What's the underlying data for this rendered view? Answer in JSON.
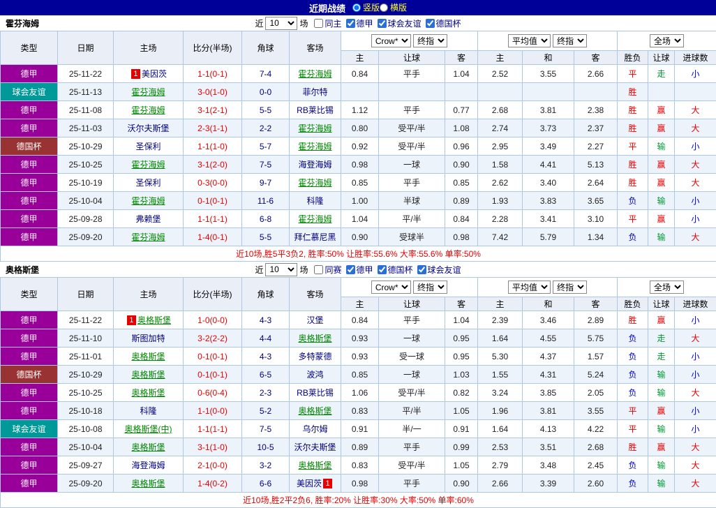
{
  "titlebar": {
    "title": "近期战绩",
    "radios": [
      {
        "label": "竖版",
        "selected": true
      },
      {
        "label": "横版",
        "selected": false
      }
    ]
  },
  "colors": {
    "titlebar_bg": "#000099",
    "type_colors": {
      "德甲": "#990099",
      "球会友谊": "#009999",
      "德国杯": "#993333"
    },
    "result_colors": {
      "red": "#e60000",
      "green": "#009933",
      "blue": "#0000cc"
    },
    "focus_team": "#008800",
    "team": "#000080",
    "score": "#e60000",
    "summary": "#e60000",
    "rank_badge": "#e60000"
  },
  "sections": [
    {
      "team": "霍芬海姆",
      "filter": {
        "near": "近",
        "count": "10",
        "games": "场",
        "checkboxes": [
          {
            "label": "同主",
            "checked": false
          },
          {
            "label": "德甲",
            "checked": true
          },
          {
            "label": "球会友谊",
            "checked": true
          },
          {
            "label": "德国杯",
            "checked": true
          }
        ]
      },
      "header": {
        "cols": [
          "类型",
          "日期",
          "主场",
          "比分(半场)",
          "角球",
          "客场"
        ],
        "odds_group": [
          "Crow*",
          "终指"
        ],
        "avg_group": [
          "平均值",
          "终指"
        ],
        "full_group": [
          "全场"
        ],
        "sub": [
          "主",
          "让球",
          "客",
          "主",
          "和",
          "客",
          "胜负",
          "让球",
          "进球数"
        ]
      },
      "rows": [
        {
          "type": "德甲",
          "date": "25-11-22",
          "home": {
            "name": "美因茨",
            "badge": "1",
            "badge_pos": "before",
            "focus": false
          },
          "score": "1-1(0-1)",
          "corners": "7-4",
          "away": {
            "name": "霍芬海姆",
            "focus": true
          },
          "odds": [
            "0.84",
            "平手",
            "1.04"
          ],
          "avg": [
            "2.52",
            "3.55",
            "2.66"
          ],
          "results": [
            {
              "text": "平",
              "color": "red"
            },
            {
              "text": "走",
              "color": "green"
            },
            {
              "text": "小",
              "color": "blue"
            }
          ]
        },
        {
          "type": "球会友谊",
          "date": "25-11-13",
          "home": {
            "name": "霍芬海姆",
            "focus": true
          },
          "score": "3-0(1-0)",
          "corners": "0-0",
          "away": {
            "name": "菲尔特",
            "focus": false
          },
          "odds": [
            "",
            "",
            ""
          ],
          "avg": [
            "",
            "",
            ""
          ],
          "results": [
            {
              "text": "胜",
              "color": "red"
            },
            {
              "text": "",
              "color": ""
            },
            {
              "text": "",
              "color": ""
            }
          ]
        },
        {
          "type": "德甲",
          "date": "25-11-08",
          "home": {
            "name": "霍芬海姆",
            "focus": true
          },
          "score": "3-1(2-1)",
          "corners": "5-5",
          "away": {
            "name": "RB莱比锡",
            "focus": false
          },
          "odds": [
            "1.12",
            "平手",
            "0.77"
          ],
          "avg": [
            "2.68",
            "3.81",
            "2.38"
          ],
          "results": [
            {
              "text": "胜",
              "color": "red"
            },
            {
              "text": "赢",
              "color": "red"
            },
            {
              "text": "大",
              "color": "red"
            }
          ]
        },
        {
          "type": "德甲",
          "date": "25-11-03",
          "home": {
            "name": "沃尔夫斯堡",
            "focus": false
          },
          "score": "2-3(1-1)",
          "corners": "2-2",
          "away": {
            "name": "霍芬海姆",
            "focus": true
          },
          "odds": [
            "0.80",
            "受平/半",
            "1.08"
          ],
          "avg": [
            "2.74",
            "3.73",
            "2.37"
          ],
          "results": [
            {
              "text": "胜",
              "color": "red"
            },
            {
              "text": "赢",
              "color": "red"
            },
            {
              "text": "大",
              "color": "red"
            }
          ]
        },
        {
          "type": "德国杯",
          "date": "25-10-29",
          "home": {
            "name": "圣保利",
            "focus": false
          },
          "score": "1-1(1-0)",
          "corners": "5-7",
          "away": {
            "name": "霍芬海姆",
            "focus": true
          },
          "odds": [
            "0.92",
            "受平/半",
            "0.96"
          ],
          "avg": [
            "2.95",
            "3.49",
            "2.27"
          ],
          "results": [
            {
              "text": "平",
              "color": "red"
            },
            {
              "text": "输",
              "color": "green"
            },
            {
              "text": "小",
              "color": "blue"
            }
          ]
        },
        {
          "type": "德甲",
          "date": "25-10-25",
          "home": {
            "name": "霍芬海姆",
            "focus": true
          },
          "score": "3-1(2-0)",
          "corners": "7-5",
          "away": {
            "name": "海登海姆",
            "focus": false
          },
          "odds": [
            "0.98",
            "一球",
            "0.90"
          ],
          "avg": [
            "1.58",
            "4.41",
            "5.13"
          ],
          "results": [
            {
              "text": "胜",
              "color": "red"
            },
            {
              "text": "赢",
              "color": "red"
            },
            {
              "text": "大",
              "color": "red"
            }
          ]
        },
        {
          "type": "德甲",
          "date": "25-10-19",
          "home": {
            "name": "圣保利",
            "focus": false
          },
          "score": "0-3(0-0)",
          "corners": "9-7",
          "away": {
            "name": "霍芬海姆",
            "focus": true
          },
          "odds": [
            "0.85",
            "平手",
            "0.85"
          ],
          "avg": [
            "2.62",
            "3.40",
            "2.64"
          ],
          "results": [
            {
              "text": "胜",
              "color": "red"
            },
            {
              "text": "赢",
              "color": "red"
            },
            {
              "text": "大",
              "color": "red"
            }
          ]
        },
        {
          "type": "德甲",
          "date": "25-10-04",
          "home": {
            "name": "霍芬海姆",
            "focus": true
          },
          "score": "0-1(0-1)",
          "corners": "11-6",
          "away": {
            "name": "科隆",
            "focus": false
          },
          "odds": [
            "1.00",
            "半球",
            "0.89"
          ],
          "avg": [
            "1.93",
            "3.83",
            "3.65"
          ],
          "results": [
            {
              "text": "负",
              "color": "blue"
            },
            {
              "text": "输",
              "color": "green"
            },
            {
              "text": "小",
              "color": "blue"
            }
          ]
        },
        {
          "type": "德甲",
          "date": "25-09-28",
          "home": {
            "name": "弗赖堡",
            "focus": false
          },
          "score": "1-1(1-1)",
          "corners": "6-8",
          "away": {
            "name": "霍芬海姆",
            "focus": true
          },
          "odds": [
            "1.04",
            "平/半",
            "0.84"
          ],
          "avg": [
            "2.28",
            "3.41",
            "3.10"
          ],
          "results": [
            {
              "text": "平",
              "color": "red"
            },
            {
              "text": "赢",
              "color": "red"
            },
            {
              "text": "小",
              "color": "blue"
            }
          ]
        },
        {
          "type": "德甲",
          "date": "25-09-20",
          "home": {
            "name": "霍芬海姆",
            "focus": true
          },
          "score": "1-4(0-1)",
          "corners": "5-5",
          "away": {
            "name": "拜仁慕尼黑",
            "focus": false
          },
          "odds": [
            "0.90",
            "受球半",
            "0.98"
          ],
          "avg": [
            "7.42",
            "5.79",
            "1.34"
          ],
          "results": [
            {
              "text": "负",
              "color": "blue"
            },
            {
              "text": "输",
              "color": "green"
            },
            {
              "text": "大",
              "color": "red"
            }
          ]
        }
      ],
      "summary": "近10场,胜5平3负2, 胜率:50% 让胜率:55.6% 大率:55.6% 单率:50%"
    },
    {
      "team": "奥格斯堡",
      "filter": {
        "near": "近",
        "count": "10",
        "games": "场",
        "checkboxes": [
          {
            "label": "同赛",
            "checked": false
          },
          {
            "label": "德甲",
            "checked": true
          },
          {
            "label": "德国杯",
            "checked": true
          },
          {
            "label": "球会友谊",
            "checked": true
          }
        ]
      },
      "header": {
        "cols": [
          "类型",
          "日期",
          "主场",
          "比分(半场)",
          "角球",
          "客场"
        ],
        "odds_group": [
          "Crow*",
          "终指"
        ],
        "avg_group": [
          "平均值",
          "终指"
        ],
        "full_group": [
          "全场"
        ],
        "sub": [
          "主",
          "让球",
          "客",
          "主",
          "和",
          "客",
          "胜负",
          "让球",
          "进球数"
        ]
      },
      "rows": [
        {
          "type": "德甲",
          "date": "25-11-22",
          "home": {
            "name": "奥格斯堡",
            "badge": "1",
            "badge_pos": "before",
            "focus": true
          },
          "score": "1-0(0-0)",
          "corners": "4-3",
          "away": {
            "name": "汉堡",
            "focus": false
          },
          "odds": [
            "0.84",
            "平手",
            "1.04"
          ],
          "avg": [
            "2.39",
            "3.46",
            "2.89"
          ],
          "results": [
            {
              "text": "胜",
              "color": "red"
            },
            {
              "text": "赢",
              "color": "red"
            },
            {
              "text": "小",
              "color": "blue"
            }
          ]
        },
        {
          "type": "德甲",
          "date": "25-11-10",
          "home": {
            "name": "斯图加特",
            "focus": false
          },
          "score": "3-2(2-2)",
          "corners": "4-4",
          "away": {
            "name": "奥格斯堡",
            "focus": true
          },
          "odds": [
            "0.93",
            "一球",
            "0.95"
          ],
          "avg": [
            "1.64",
            "4.55",
            "5.75"
          ],
          "results": [
            {
              "text": "负",
              "color": "blue"
            },
            {
              "text": "走",
              "color": "green"
            },
            {
              "text": "大",
              "color": "red"
            }
          ]
        },
        {
          "type": "德甲",
          "date": "25-11-01",
          "home": {
            "name": "奥格斯堡",
            "focus": true
          },
          "score": "0-1(0-1)",
          "corners": "4-3",
          "away": {
            "name": "多特蒙德",
            "focus": false
          },
          "odds": [
            "0.93",
            "受一球",
            "0.95"
          ],
          "avg": [
            "5.30",
            "4.37",
            "1.57"
          ],
          "results": [
            {
              "text": "负",
              "color": "blue"
            },
            {
              "text": "走",
              "color": "green"
            },
            {
              "text": "小",
              "color": "blue"
            }
          ]
        },
        {
          "type": "德国杯",
          "date": "25-10-29",
          "home": {
            "name": "奥格斯堡",
            "focus": true
          },
          "score": "0-1(0-1)",
          "corners": "6-5",
          "away": {
            "name": "波鸿",
            "focus": false
          },
          "odds": [
            "0.85",
            "一球",
            "1.03"
          ],
          "avg": [
            "1.55",
            "4.31",
            "5.24"
          ],
          "results": [
            {
              "text": "负",
              "color": "blue"
            },
            {
              "text": "输",
              "color": "green"
            },
            {
              "text": "小",
              "color": "blue"
            }
          ]
        },
        {
          "type": "德甲",
          "date": "25-10-25",
          "home": {
            "name": "奥格斯堡",
            "focus": true
          },
          "score": "0-6(0-4)",
          "corners": "2-3",
          "away": {
            "name": "RB莱比锡",
            "focus": false
          },
          "odds": [
            "1.06",
            "受平/半",
            "0.82"
          ],
          "avg": [
            "3.24",
            "3.85",
            "2.05"
          ],
          "results": [
            {
              "text": "负",
              "color": "blue"
            },
            {
              "text": "输",
              "color": "green"
            },
            {
              "text": "大",
              "color": "red"
            }
          ]
        },
        {
          "type": "德甲",
          "date": "25-10-18",
          "home": {
            "name": "科隆",
            "focus": false
          },
          "score": "1-1(0-0)",
          "corners": "5-2",
          "away": {
            "name": "奥格斯堡",
            "focus": true
          },
          "odds": [
            "0.83",
            "平/半",
            "1.05"
          ],
          "avg": [
            "1.96",
            "3.81",
            "3.55"
          ],
          "results": [
            {
              "text": "平",
              "color": "red"
            },
            {
              "text": "赢",
              "color": "red"
            },
            {
              "text": "小",
              "color": "blue"
            }
          ]
        },
        {
          "type": "球会友谊",
          "date": "25-10-08",
          "home": {
            "name": "奥格斯堡(中)",
            "focus": true
          },
          "score": "1-1(1-1)",
          "corners": "7-5",
          "away": {
            "name": "乌尔姆",
            "focus": false
          },
          "odds": [
            "0.91",
            "半/一",
            "0.91"
          ],
          "avg": [
            "1.64",
            "4.13",
            "4.22"
          ],
          "results": [
            {
              "text": "平",
              "color": "red"
            },
            {
              "text": "输",
              "color": "green"
            },
            {
              "text": "小",
              "color": "blue"
            }
          ]
        },
        {
          "type": "德甲",
          "date": "25-10-04",
          "home": {
            "name": "奥格斯堡",
            "focus": true
          },
          "score": "3-1(1-0)",
          "corners": "10-5",
          "away": {
            "name": "沃尔夫斯堡",
            "focus": false
          },
          "odds": [
            "0.89",
            "平手",
            "0.99"
          ],
          "avg": [
            "2.53",
            "3.51",
            "2.68"
          ],
          "results": [
            {
              "text": "胜",
              "color": "red"
            },
            {
              "text": "赢",
              "color": "red"
            },
            {
              "text": "大",
              "color": "red"
            }
          ]
        },
        {
          "type": "德甲",
          "date": "25-09-27",
          "home": {
            "name": "海登海姆",
            "focus": false
          },
          "score": "2-1(0-0)",
          "corners": "3-2",
          "away": {
            "name": "奥格斯堡",
            "focus": true
          },
          "odds": [
            "0.83",
            "受平/半",
            "1.05"
          ],
          "avg": [
            "2.79",
            "3.48",
            "2.45"
          ],
          "results": [
            {
              "text": "负",
              "color": "blue"
            },
            {
              "text": "输",
              "color": "green"
            },
            {
              "text": "大",
              "color": "red"
            }
          ]
        },
        {
          "type": "德甲",
          "date": "25-09-20",
          "home": {
            "name": "奥格斯堡",
            "focus": true
          },
          "score": "1-4(0-2)",
          "corners": "6-6",
          "away": {
            "name": "美因茨",
            "badge": "1",
            "badge_pos": "after",
            "focus": false
          },
          "odds": [
            "0.98",
            "平手",
            "0.90"
          ],
          "avg": [
            "2.66",
            "3.39",
            "2.60"
          ],
          "results": [
            {
              "text": "负",
              "color": "blue"
            },
            {
              "text": "输",
              "color": "green"
            },
            {
              "text": "大",
              "color": "red"
            }
          ]
        }
      ],
      "summary": "近10场,胜2平2负6, 胜率:20% 让胜率:30% 大率:50% 单率:60%"
    }
  ]
}
